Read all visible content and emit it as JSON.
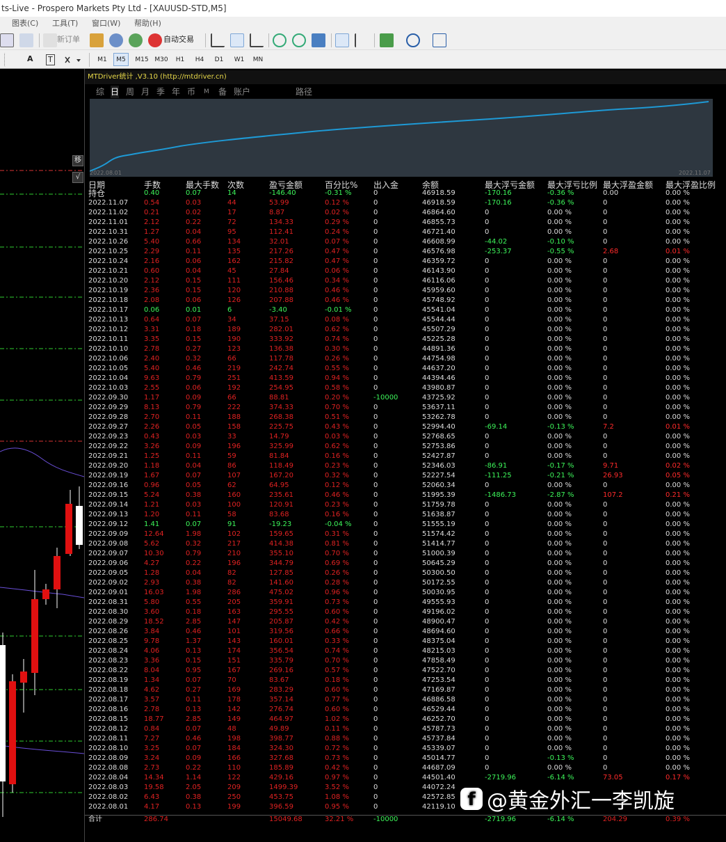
{
  "window": {
    "title": "ts-Live - Prospero Markets Pty Ltd - [XAUUSD-STD,M5]"
  },
  "menu": [
    "图表(C)",
    "工具(T)",
    "窗口(W)",
    "帮助(H)"
  ],
  "toolbar": {
    "new_order": "新订单",
    "auto_trade": "自动交易"
  },
  "timeframes": [
    "M1",
    "M5",
    "M15",
    "M30",
    "H1",
    "H4",
    "D1",
    "W1",
    "MN"
  ],
  "active_timeframe": "M5",
  "toolbar2_labels": {
    "text": "A",
    "text_label": "T"
  },
  "side_buttons": [
    "移",
    "√"
  ],
  "panel": {
    "title": "MTDriver统计 ,V3.10 (http://mtdriver.cn)",
    "tabs": [
      "综",
      "日",
      "周",
      "月",
      "季",
      "年",
      "币",
      "M",
      "备",
      "账户",
      "路径"
    ],
    "active_tab": "日",
    "equity_start": "2022.08.01",
    "equity_end": "2022.11.07",
    "headers": [
      "日期",
      "手数",
      "最大手数",
      "次数",
      "盈亏金额",
      "百分比%",
      "出入金",
      "余额",
      "最大浮亏金额",
      "最大浮亏比例",
      "最大浮盈金额",
      "最大浮盈比例"
    ],
    "rows": [
      [
        "持仓",
        "0.40",
        "0.07",
        "14",
        "-146.40",
        "-0.31 %",
        "0",
        "46918.59",
        "-170.16",
        "-0.36 %",
        "0.00",
        "0.00 %"
      ],
      [
        "2022.11.07",
        "0.54",
        "0.03",
        "44",
        "53.99",
        "0.12 %",
        "0",
        "46918.59",
        "-170.16",
        "-0.36 %",
        "0",
        "0.00 %"
      ],
      [
        "2022.11.02",
        "0.21",
        "0.02",
        "17",
        "8.87",
        "0.02 %",
        "0",
        "46864.60",
        "0",
        "0.00 %",
        "0",
        "0.00 %"
      ],
      [
        "2022.11.01",
        "2.12",
        "0.22",
        "72",
        "134.33",
        "0.29 %",
        "0",
        "46855.73",
        "0",
        "0.00 %",
        "0",
        "0.00 %"
      ],
      [
        "2022.10.31",
        "1.27",
        "0.04",
        "95",
        "112.41",
        "0.24 %",
        "0",
        "46721.40",
        "0",
        "0.00 %",
        "0",
        "0.00 %"
      ],
      [
        "2022.10.26",
        "5.40",
        "0.66",
        "134",
        "32.01",
        "0.07 %",
        "0",
        "46608.99",
        "-44.02",
        "-0.10 %",
        "0",
        "0.00 %"
      ],
      [
        "2022.10.25",
        "2.29",
        "0.11",
        "135",
        "217.26",
        "0.47 %",
        "0",
        "46576.98",
        "-253.37",
        "-0.55 %",
        "2.68",
        "0.01 %"
      ],
      [
        "2022.10.24",
        "2.16",
        "0.06",
        "162",
        "215.82",
        "0.47 %",
        "0",
        "46359.72",
        "0",
        "0.00 %",
        "0",
        "0.00 %"
      ],
      [
        "2022.10.21",
        "0.60",
        "0.04",
        "45",
        "27.84",
        "0.06 %",
        "0",
        "46143.90",
        "0",
        "0.00 %",
        "0",
        "0.00 %"
      ],
      [
        "2022.10.20",
        "2.12",
        "0.15",
        "111",
        "156.46",
        "0.34 %",
        "0",
        "46116.06",
        "0",
        "0.00 %",
        "0",
        "0.00 %"
      ],
      [
        "2022.10.19",
        "2.36",
        "0.15",
        "120",
        "210.88",
        "0.46 %",
        "0",
        "45959.60",
        "0",
        "0.00 %",
        "0",
        "0.00 %"
      ],
      [
        "2022.10.18",
        "2.08",
        "0.06",
        "126",
        "207.88",
        "0.46 %",
        "0",
        "45748.92",
        "0",
        "0.00 %",
        "0",
        "0.00 %"
      ],
      [
        "2022.10.17",
        "0.06",
        "0.01",
        "6",
        "-3.40",
        "-0.01 %",
        "0",
        "45541.04",
        "0",
        "0.00 %",
        "0",
        "0.00 %"
      ],
      [
        "2022.10.13",
        "0.64",
        "0.07",
        "34",
        "37.15",
        "0.08 %",
        "0",
        "45544.44",
        "0",
        "0.00 %",
        "0",
        "0.00 %"
      ],
      [
        "2022.10.12",
        "3.31",
        "0.18",
        "189",
        "282.01",
        "0.62 %",
        "0",
        "45507.29",
        "0",
        "0.00 %",
        "0",
        "0.00 %"
      ],
      [
        "2022.10.11",
        "3.35",
        "0.15",
        "190",
        "333.92",
        "0.74 %",
        "0",
        "45225.28",
        "0",
        "0.00 %",
        "0",
        "0.00 %"
      ],
      [
        "2022.10.10",
        "2.78",
        "0.27",
        "123",
        "136.38",
        "0.30 %",
        "0",
        "44891.36",
        "0",
        "0.00 %",
        "0",
        "0.00 %"
      ],
      [
        "2022.10.06",
        "2.40",
        "0.32",
        "66",
        "117.78",
        "0.26 %",
        "0",
        "44754.98",
        "0",
        "0.00 %",
        "0",
        "0.00 %"
      ],
      [
        "2022.10.05",
        "5.40",
        "0.46",
        "219",
        "242.74",
        "0.55 %",
        "0",
        "44637.20",
        "0",
        "0.00 %",
        "0",
        "0.00 %"
      ],
      [
        "2022.10.04",
        "9.63",
        "0.79",
        "251",
        "413.59",
        "0.94 %",
        "0",
        "44394.46",
        "0",
        "0.00 %",
        "0",
        "0.00 %"
      ],
      [
        "2022.10.03",
        "2.55",
        "0.06",
        "192",
        "254.95",
        "0.58 %",
        "0",
        "43980.87",
        "0",
        "0.00 %",
        "0",
        "0.00 %"
      ],
      [
        "2022.09.30",
        "1.17",
        "0.09",
        "66",
        "88.81",
        "0.20 %",
        "-10000",
        "43725.92",
        "0",
        "0.00 %",
        "0",
        "0.00 %"
      ],
      [
        "2022.09.29",
        "8.13",
        "0.79",
        "222",
        "374.33",
        "0.70 %",
        "0",
        "53637.11",
        "0",
        "0.00 %",
        "0",
        "0.00 %"
      ],
      [
        "2022.09.28",
        "2.70",
        "0.11",
        "188",
        "268.38",
        "0.51 %",
        "0",
        "53262.78",
        "0",
        "0.00 %",
        "0",
        "0.00 %"
      ],
      [
        "2022.09.27",
        "2.26",
        "0.05",
        "158",
        "225.75",
        "0.43 %",
        "0",
        "52994.40",
        "-69.14",
        "-0.13 %",
        "7.2",
        "0.01 %"
      ],
      [
        "2022.09.23",
        "0.43",
        "0.03",
        "33",
        "14.79",
        "0.03 %",
        "0",
        "52768.65",
        "0",
        "0.00 %",
        "0",
        "0.00 %"
      ],
      [
        "2022.09.22",
        "3.26",
        "0.09",
        "196",
        "325.99",
        "0.62 %",
        "0",
        "52753.86",
        "0",
        "0.00 %",
        "0",
        "0.00 %"
      ],
      [
        "2022.09.21",
        "1.25",
        "0.11",
        "59",
        "81.84",
        "0.16 %",
        "0",
        "52427.87",
        "0",
        "0.00 %",
        "0",
        "0.00 %"
      ],
      [
        "2022.09.20",
        "1.18",
        "0.04",
        "86",
        "118.49",
        "0.23 %",
        "0",
        "52346.03",
        "-86.91",
        "-0.17 %",
        "9.71",
        "0.02 %"
      ],
      [
        "2022.09.19",
        "1.67",
        "0.07",
        "107",
        "167.20",
        "0.32 %",
        "0",
        "52227.54",
        "-111.25",
        "-0.21 %",
        "26.93",
        "0.05 %"
      ],
      [
        "2022.09.16",
        "0.96",
        "0.05",
        "62",
        "64.95",
        "0.12 %",
        "0",
        "52060.34",
        "0",
        "0.00 %",
        "0",
        "0.00 %"
      ],
      [
        "2022.09.15",
        "5.24",
        "0.38",
        "160",
        "235.61",
        "0.46 %",
        "0",
        "51995.39",
        "-1486.73",
        "-2.87 %",
        "107.2",
        "0.21 %"
      ],
      [
        "2022.09.14",
        "1.21",
        "0.03",
        "100",
        "120.91",
        "0.23 %",
        "0",
        "51759.78",
        "0",
        "0.00 %",
        "0",
        "0.00 %"
      ],
      [
        "2022.09.13",
        "1.20",
        "0.11",
        "58",
        "83.68",
        "0.16 %",
        "0",
        "51638.87",
        "0",
        "0.00 %",
        "0",
        "0.00 %"
      ],
      [
        "2022.09.12",
        "1.41",
        "0.07",
        "91",
        "-19.23",
        "-0.04 %",
        "0",
        "51555.19",
        "0",
        "0.00 %",
        "0",
        "0.00 %"
      ],
      [
        "2022.09.09",
        "12.64",
        "1.98",
        "102",
        "159.65",
        "0.31 %",
        "0",
        "51574.42",
        "0",
        "0.00 %",
        "0",
        "0.00 %"
      ],
      [
        "2022.09.08",
        "5.62",
        "0.32",
        "217",
        "414.38",
        "0.81 %",
        "0",
        "51414.77",
        "0",
        "0.00 %",
        "0",
        "0.00 %"
      ],
      [
        "2022.09.07",
        "10.30",
        "0.79",
        "210",
        "355.10",
        "0.70 %",
        "0",
        "51000.39",
        "0",
        "0.00 %",
        "0",
        "0.00 %"
      ],
      [
        "2022.09.06",
        "4.27",
        "0.22",
        "196",
        "344.79",
        "0.69 %",
        "0",
        "50645.29",
        "0",
        "0.00 %",
        "0",
        "0.00 %"
      ],
      [
        "2022.09.05",
        "1.28",
        "0.04",
        "82",
        "127.85",
        "0.26 %",
        "0",
        "50300.50",
        "0",
        "0.00 %",
        "0",
        "0.00 %"
      ],
      [
        "2022.09.02",
        "2.93",
        "0.38",
        "82",
        "141.60",
        "0.28 %",
        "0",
        "50172.55",
        "0",
        "0.00 %",
        "0",
        "0.00 %"
      ],
      [
        "2022.09.01",
        "16.03",
        "1.98",
        "286",
        "475.02",
        "0.96 %",
        "0",
        "50030.95",
        "0",
        "0.00 %",
        "0",
        "0.00 %"
      ],
      [
        "2022.08.31",
        "5.80",
        "0.55",
        "205",
        "359.91",
        "0.73 %",
        "0",
        "49555.93",
        "0",
        "0.00 %",
        "0",
        "0.00 %"
      ],
      [
        "2022.08.30",
        "3.60",
        "0.18",
        "163",
        "295.55",
        "0.60 %",
        "0",
        "49196.02",
        "0",
        "0.00 %",
        "0",
        "0.00 %"
      ],
      [
        "2022.08.29",
        "18.52",
        "2.85",
        "147",
        "205.87",
        "0.42 %",
        "0",
        "48900.47",
        "0",
        "0.00 %",
        "0",
        "0.00 %"
      ],
      [
        "2022.08.26",
        "3.84",
        "0.46",
        "101",
        "319.56",
        "0.66 %",
        "0",
        "48694.60",
        "0",
        "0.00 %",
        "0",
        "0.00 %"
      ],
      [
        "2022.08.25",
        "9.78",
        "1.37",
        "143",
        "160.01",
        "0.33 %",
        "0",
        "48375.04",
        "0",
        "0.00 %",
        "0",
        "0.00 %"
      ],
      [
        "2022.08.24",
        "4.06",
        "0.13",
        "174",
        "356.54",
        "0.74 %",
        "0",
        "48215.03",
        "0",
        "0.00 %",
        "0",
        "0.00 %"
      ],
      [
        "2022.08.23",
        "3.36",
        "0.15",
        "151",
        "335.79",
        "0.70 %",
        "0",
        "47858.49",
        "0",
        "0.00 %",
        "0",
        "0.00 %"
      ],
      [
        "2022.08.22",
        "8.04",
        "0.95",
        "167",
        "269.16",
        "0.57 %",
        "0",
        "47522.70",
        "0",
        "0.00 %",
        "0",
        "0.00 %"
      ],
      [
        "2022.08.19",
        "1.34",
        "0.07",
        "70",
        "83.67",
        "0.18 %",
        "0",
        "47253.54",
        "0",
        "0.00 %",
        "0",
        "0.00 %"
      ],
      [
        "2022.08.18",
        "4.62",
        "0.27",
        "169",
        "283.29",
        "0.60 %",
        "0",
        "47169.87",
        "0",
        "0.00 %",
        "0",
        "0.00 %"
      ],
      [
        "2022.08.17",
        "3.57",
        "0.11",
        "178",
        "357.14",
        "0.77 %",
        "0",
        "46886.58",
        "0",
        "0.00 %",
        "0",
        "0.00 %"
      ],
      [
        "2022.08.16",
        "2.78",
        "0.13",
        "142",
        "276.74",
        "0.60 %",
        "0",
        "46529.44",
        "0",
        "0.00 %",
        "0",
        "0.00 %"
      ],
      [
        "2022.08.15",
        "18.77",
        "2.85",
        "149",
        "464.97",
        "1.02 %",
        "0",
        "46252.70",
        "0",
        "0.00 %",
        "0",
        "0.00 %"
      ],
      [
        "2022.08.12",
        "0.84",
        "0.07",
        "48",
        "49.89",
        "0.11 %",
        "0",
        "45787.73",
        "0",
        "0.00 %",
        "0",
        "0.00 %"
      ],
      [
        "2022.08.11",
        "7.27",
        "0.46",
        "198",
        "398.77",
        "0.88 %",
        "0",
        "45737.84",
        "0",
        "0.00 %",
        "0",
        "0.00 %"
      ],
      [
        "2022.08.10",
        "3.25",
        "0.07",
        "184",
        "324.30",
        "0.72 %",
        "0",
        "45339.07",
        "0",
        "0.00 %",
        "0",
        "0.00 %"
      ],
      [
        "2022.08.09",
        "3.24",
        "0.09",
        "166",
        "327.68",
        "0.73 %",
        "0",
        "45014.77",
        "0",
        "-0.13 %",
        "0",
        "0.00 %"
      ],
      [
        "2022.08.08",
        "2.73",
        "0.22",
        "110",
        "185.89",
        "0.42 %",
        "0",
        "44687.09",
        "0",
        "0.00 %",
        "0",
        "0.00 %"
      ],
      [
        "2022.08.04",
        "14.34",
        "1.14",
        "122",
        "429.16",
        "0.97 %",
        "0",
        "44501.40",
        "-2719.96",
        "-6.14 %",
        "73.05",
        "0.17 %"
      ],
      [
        "2022.08.03",
        "19.58",
        "2.05",
        "209",
        "1499.39",
        "3.52 %",
        "0",
        "44072.24",
        "",
        "",
        "",
        ""
      ],
      [
        "2022.08.02",
        "6.43",
        "0.38",
        "250",
        "453.75",
        "1.08 %",
        "0",
        "42572.85",
        "",
        "",
        "",
        ""
      ],
      [
        "2022.08.01",
        "4.17",
        "0.13",
        "199",
        "396.59",
        "0.95 %",
        "0",
        "42119.10",
        "",
        "",
        "",
        ""
      ]
    ],
    "total": [
      "合计",
      "286.74",
      "",
      "",
      "15049.68",
      "32.21 %",
      "-10000",
      "",
      "-2719.96",
      "-6.14 %",
      "204.29",
      "0.39 %"
    ]
  },
  "watermark": "@黄金外汇一李凯旋",
  "colors": {
    "profit": "#e02222",
    "loss": "#3df55a",
    "neutral": "#dddddd",
    "equity_line": "#1e9ad6",
    "panel_title": "#e8d94a"
  }
}
